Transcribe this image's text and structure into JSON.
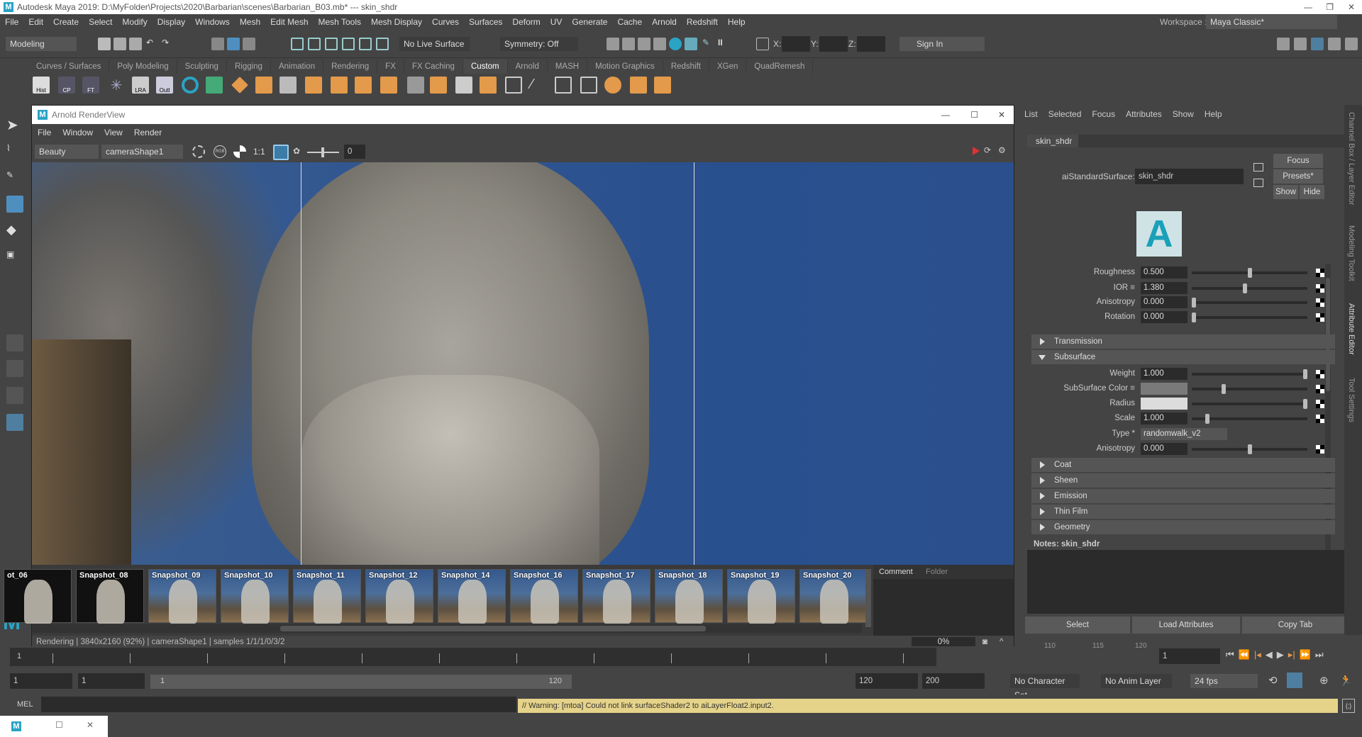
{
  "window": {
    "title": "Autodesk Maya 2019: D:\\MyFolder\\Projects\\2020\\Barbarian\\scenes\\Barbarian_B03.mb*  ---  skin_shdr"
  },
  "menu": [
    "File",
    "Edit",
    "Create",
    "Select",
    "Modify",
    "Display",
    "Windows",
    "Mesh",
    "Edit Mesh",
    "Mesh Tools",
    "Mesh Display",
    "Curves",
    "Surfaces",
    "Deform",
    "UV",
    "Generate",
    "Cache",
    "Arnold",
    "Redshift",
    "Help"
  ],
  "status_line": {
    "mode": "Modeling",
    "live_surface": "No Live Surface",
    "symmetry": "Symmetry: Off",
    "x_label": "X:",
    "y_label": "Y:",
    "z_label": "Z:",
    "sign_in": "Sign In",
    "workspace_label": "Workspace :",
    "workspace": "Maya Classic*"
  },
  "shelf_tabs": [
    "Curves / Surfaces",
    "Poly Modeling",
    "Sculpting",
    "Rigging",
    "Animation",
    "Rendering",
    "FX",
    "FX Caching",
    "Custom",
    "Arnold",
    "MASH",
    "Motion Graphics",
    "Redshift",
    "XGen",
    "QuadRemesh"
  ],
  "shelf_active": "Custom",
  "shelf_labels": [
    "Hist",
    "CP",
    "FT",
    "LRA",
    "Outl"
  ],
  "renderview": {
    "title": "Arnold RenderView",
    "menu": [
      "File",
      "Window",
      "View",
      "Render"
    ],
    "aov": "Beauty",
    "camera": "cameraShape1",
    "ratio": "1:1",
    "exposure": "0",
    "snapshots": [
      "ot_06",
      "Snapshot_08",
      "Snapshot_09",
      "Snapshot_10",
      "Snapshot_11",
      "Snapshot_12",
      "Snapshot_14",
      "Snapshot_16",
      "Snapshot_17",
      "Snapshot_18",
      "Snapshot_19",
      "Snapshot_20"
    ],
    "comment_tabs": [
      "Comment",
      "Folder"
    ],
    "status": "Rendering | 3840x2160 (92%) | cameraShape1  | samples 1/1/1/0/3/2",
    "progress": "0%",
    "progress_value": 0
  },
  "attr_editor": {
    "menu": [
      "List",
      "Selected",
      "Focus",
      "Attributes",
      "Show",
      "Help"
    ],
    "tab": "skin_shdr",
    "node_label": "aiStandardSurface:",
    "node_name": "skin_shdr",
    "buttons": {
      "focus": "Focus",
      "presets": "Presets*",
      "show": "Show",
      "hide": "Hide"
    },
    "specular": [
      {
        "label": "Roughness",
        "value": "0.500",
        "slider": 0.5
      },
      {
        "label": "IOR ≡",
        "value": "1.380",
        "slider": 0.46
      },
      {
        "label": "Anisotropy",
        "value": "0.000",
        "slider": 0
      },
      {
        "label": "Rotation",
        "value": "0.000",
        "slider": 0
      }
    ],
    "sections": {
      "transmission": "Transmission",
      "subsurface": "Subsurface",
      "coat": "Coat",
      "sheen": "Sheen",
      "emission": "Emission",
      "thin_film": "Thin Film",
      "geometry": "Geometry"
    },
    "subsurface": {
      "weight": {
        "label": "Weight",
        "value": "1.000",
        "slider": 1
      },
      "color": {
        "label": "SubSurface Color ≡",
        "swatch": "#7a7a7a",
        "slider": 0.27
      },
      "radius": {
        "label": "Radius",
        "swatch": "#dcdcdc",
        "slider": 1
      },
      "scale": {
        "label": "Scale",
        "value": "1.000",
        "slider": 0.12
      },
      "type": {
        "label": "Type *",
        "value": "randomwalk_v2"
      },
      "anisotropy": {
        "label": "Anisotropy",
        "value": "0.000",
        "slider": 0.5
      }
    },
    "notes_label": "Notes:  skin_shdr",
    "bottom_buttons": [
      "Select",
      "Load Attributes",
      "Copy Tab"
    ]
  },
  "side_tabs": [
    "Channel Box / Layer Editor",
    "Modeling Toolkit",
    "Attribute Editor",
    "Tool Settings"
  ],
  "timeline": {
    "start_tick": "1",
    "ticks": [
      "110",
      "115",
      "120"
    ],
    "current_frame": "1"
  },
  "range": {
    "start": "1",
    "playback_start": "1",
    "slider_start": "1",
    "slider_end": "120",
    "end": "120",
    "anim_end": "200",
    "character_set": "No Character Set",
    "anim_layer": "No Anim Layer",
    "fps": "24 fps"
  },
  "command_line": {
    "lang": "MEL",
    "message": "// Warning: [mtoa] Could not link surfaceShader2 to aiLayerFloat2.input2."
  },
  "colors": {
    "accent": "#2aa3c4",
    "warning_bg": "#e5d38a",
    "panel": "#444444"
  }
}
